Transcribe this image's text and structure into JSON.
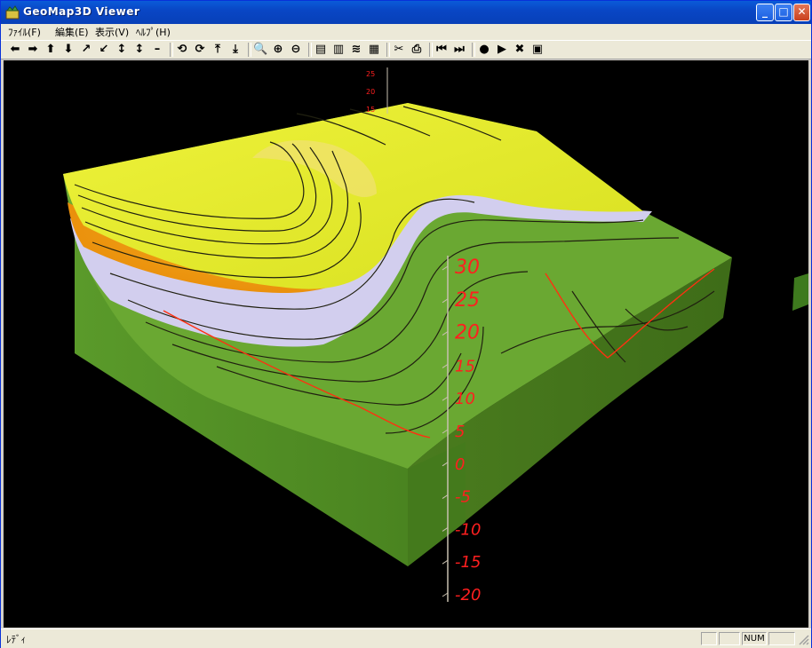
{
  "window": {
    "title": "GeoMap3D Viewer",
    "controls": {
      "minimize": "_",
      "maximize": "□",
      "close": "✕"
    }
  },
  "menu": [
    {
      "label": "ﾌｧｲﾙ(F)"
    },
    {
      "label": "編集(E)"
    },
    {
      "label": "表示(V)"
    },
    {
      "label": "ﾍﾙﾌﾟ(H)"
    }
  ],
  "toolbar": {
    "tools": [
      {
        "name": "arrow-left-icon",
        "glyph": "⬅"
      },
      {
        "name": "arrow-right-icon",
        "glyph": "➡"
      },
      {
        "name": "arrow-up-icon",
        "glyph": "⬆"
      },
      {
        "name": "arrow-down-icon",
        "glyph": "⬇"
      },
      {
        "name": "arrow-up-right-icon",
        "glyph": "↗"
      },
      {
        "name": "arrow-down-left-icon",
        "glyph": "↙"
      },
      {
        "name": "vertical-expand-icon",
        "glyph": "↕"
      },
      {
        "name": "vertical-shrink-icon",
        "glyph": "↕"
      },
      {
        "name": "minus-icon",
        "glyph": "–"
      },
      {
        "name": "rotate-left-icon",
        "glyph": "⟲"
      },
      {
        "name": "rotate-right-icon",
        "glyph": "⟳"
      },
      {
        "name": "tilt-up-icon",
        "glyph": "⤒"
      },
      {
        "name": "tilt-down-icon",
        "glyph": "⤓"
      },
      {
        "name": "zoom-icon",
        "glyph": "🔍"
      },
      {
        "name": "zoom-in-icon",
        "glyph": "⊕"
      },
      {
        "name": "zoom-out-icon",
        "glyph": "⊖"
      },
      {
        "name": "layers-icon",
        "glyph": "▤"
      },
      {
        "name": "section-icon",
        "glyph": "▥"
      },
      {
        "name": "strata-icon",
        "glyph": "≋"
      },
      {
        "name": "map-icon",
        "glyph": "▦"
      },
      {
        "name": "cut-icon",
        "glyph": "✂"
      },
      {
        "name": "print-icon",
        "glyph": "⎙"
      },
      {
        "name": "rewind-icon",
        "glyph": "⏮"
      },
      {
        "name": "fast-forward-icon",
        "glyph": "⏭"
      },
      {
        "name": "stop-icon",
        "glyph": "●"
      },
      {
        "name": "play-icon",
        "glyph": "▶"
      },
      {
        "name": "cancel-icon",
        "glyph": "✖"
      },
      {
        "name": "camera-icon",
        "glyph": "▣"
      }
    ]
  },
  "scale": {
    "labels": [
      "30",
      "25",
      "20",
      "15",
      "10",
      "5",
      "0",
      "-5",
      "-10",
      "-15",
      "-20"
    ],
    "top_labels": [
      "25",
      "20",
      "15"
    ],
    "color": "#ff1f1f"
  },
  "colors": {
    "top_yellow": "#e8ee2a",
    "orange": "#f09a10",
    "lavender": "#c8c4e8",
    "green": "#5aa02a",
    "side_dark": "#3c6e1c",
    "side_front": "#4c8a22"
  },
  "status": {
    "text": "ﾚﾃﾞｨ",
    "num": "NUM"
  }
}
